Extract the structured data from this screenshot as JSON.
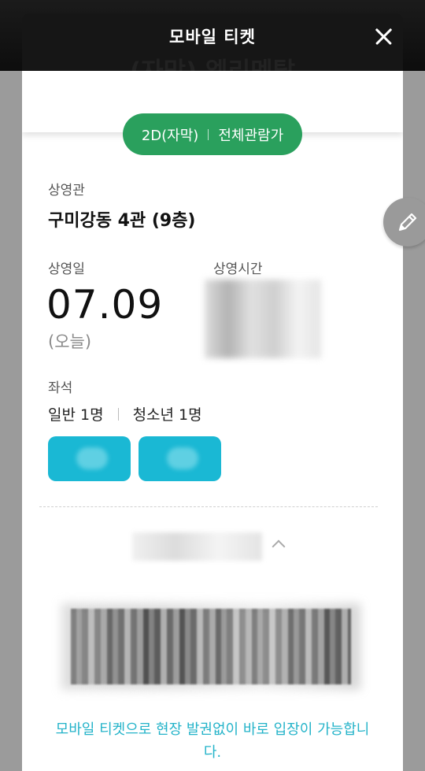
{
  "header": {
    "title": "모바일 티켓",
    "movie_title": "(자막) 엘리멘탈"
  },
  "ticket": {
    "format": "2D(자막)",
    "rating": "전체관람가",
    "theater_label": "상영관",
    "theater_name": "구미강동 4관 (9층)",
    "date_label": "상영일",
    "date_value": "07.09",
    "date_sub": "(오늘)",
    "time_label": "상영시간",
    "seat_label": "좌석",
    "seat_adult": "일반 1명",
    "seat_youth": "청소년 1명",
    "notice": "모바일 티켓으로 현장 발권없이 바로 입장이 가능합니다."
  },
  "colors": {
    "accent_green": "#2aa05d",
    "accent_cyan": "#1ab8d4",
    "notice_text": "#23b3c9"
  },
  "icons": {
    "close": "close-icon",
    "edit": "pencil-icon",
    "collapse": "chevron-up-icon"
  }
}
